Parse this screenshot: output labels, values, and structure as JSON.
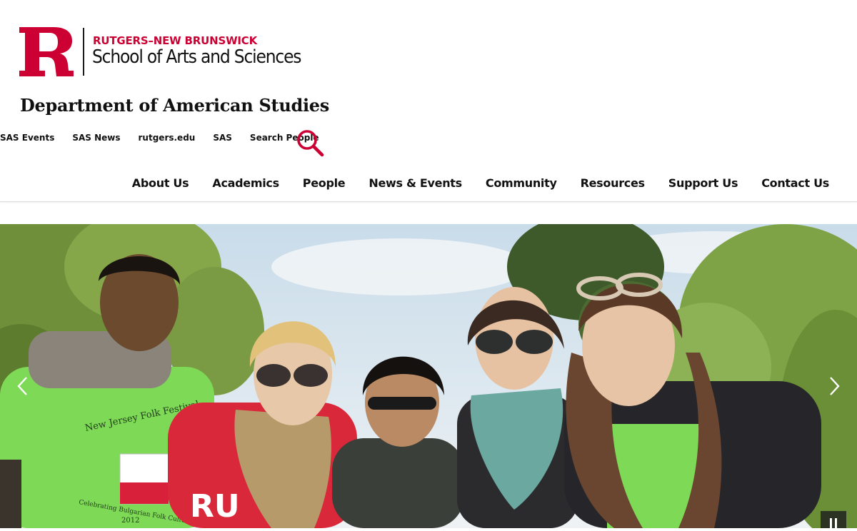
{
  "logo": {
    "top_line": "RUTGERS–NEW BRUNSWICK",
    "bottom_line": "School of Arts and Sciences",
    "brand_color": "#cc0033"
  },
  "department": {
    "title": "Department of American Studies"
  },
  "utility_nav": {
    "links": [
      "SAS Events",
      "SAS News",
      "rutgers.edu",
      "SAS",
      "Search People"
    ],
    "search_icon": "search-icon"
  },
  "main_nav": {
    "items": [
      "About Us",
      "Academics",
      "People",
      "News & Events",
      "Community",
      "Resources",
      "Support Us",
      "Contact Us"
    ]
  },
  "hero": {
    "shirt_text_1": "New Jersey Folk Festival",
    "shirt_text_2": "Celebrating Bulgarian Folk Culture",
    "shirt_year": "2012",
    "hoodie_text": "RU",
    "controls": {
      "prev_icon": "chevron-left-icon",
      "next_icon": "chevron-right-icon",
      "pause_icon": "pause-icon"
    }
  }
}
